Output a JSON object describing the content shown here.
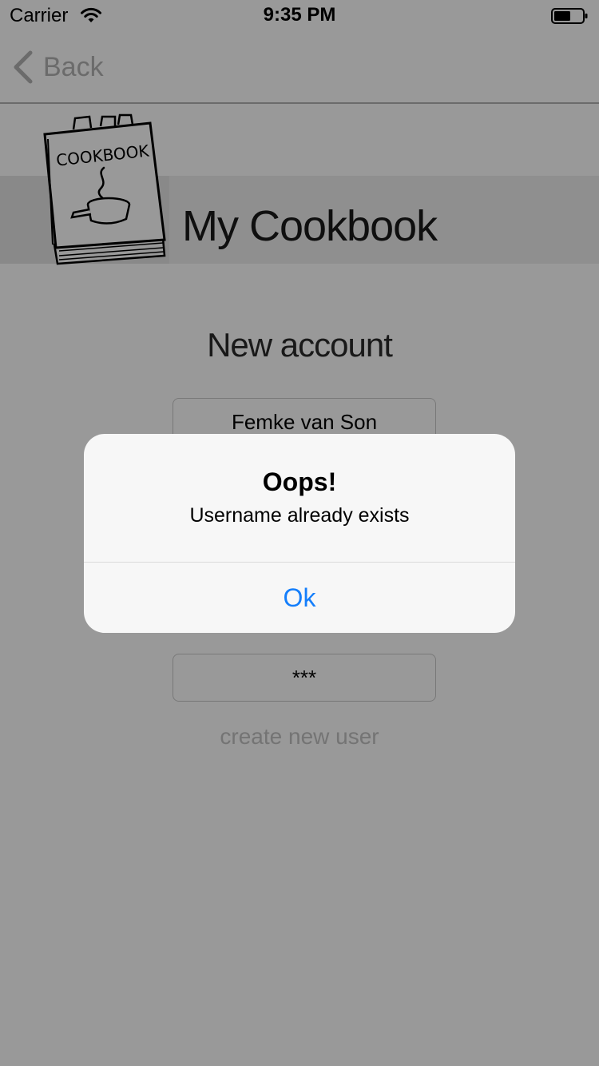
{
  "status_bar": {
    "carrier": "Carrier",
    "time": "9:35 PM",
    "wifi_icon": "wifi-icon",
    "battery_icon": "battery-icon"
  },
  "nav": {
    "back_label": "Back",
    "back_icon": "chevron-left-icon"
  },
  "header": {
    "logo_text": "COOKBOOK",
    "title": "My Cookbook"
  },
  "form": {
    "section_title": "New account",
    "username_value": "Femke van Son",
    "password_value": "***",
    "create_button_label": "create new user"
  },
  "alert": {
    "title": "Oops!",
    "message": "Username already exists",
    "ok_label": "Ok"
  },
  "colors": {
    "accent": "#147efb",
    "overlay": "rgba(0,0,0,0.40)"
  }
}
